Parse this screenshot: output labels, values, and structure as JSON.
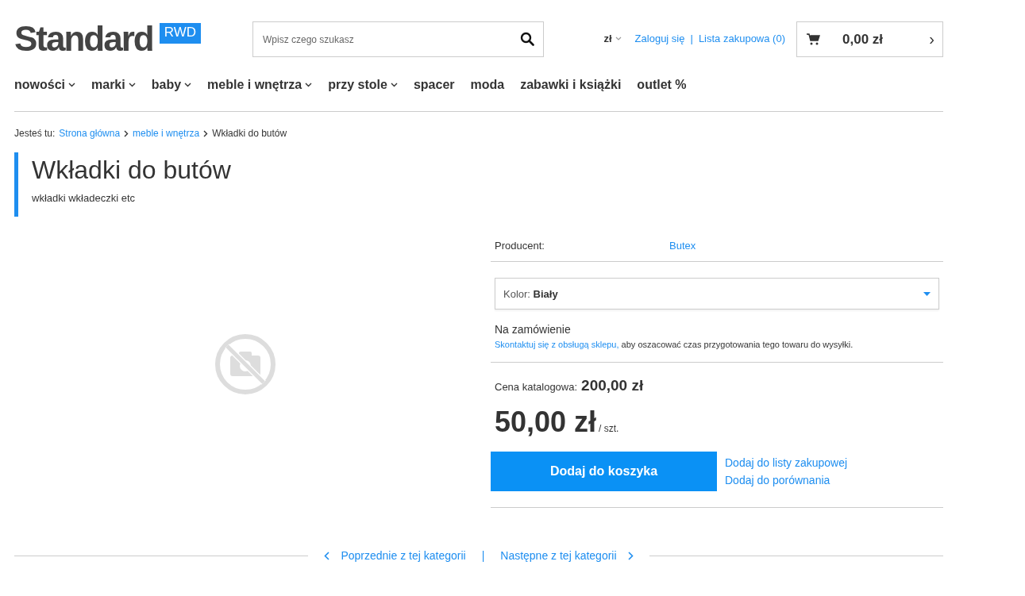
{
  "logo": {
    "text": "Standard",
    "badge": "RWD"
  },
  "search": {
    "placeholder": "Wpisz czego szukasz"
  },
  "currency": {
    "label": "zł",
    "has_dropdown": true
  },
  "account_links": [
    {
      "label": "Zaloguj się"
    },
    {
      "label": "Lista zakupowa (0)"
    }
  ],
  "account_separator": "|",
  "cart": {
    "total": "0,00 zł",
    "arrow": "›"
  },
  "nav": [
    {
      "label": "nowości",
      "has_dropdown": true
    },
    {
      "label": "marki",
      "has_dropdown": true
    },
    {
      "label": "baby",
      "has_dropdown": true
    },
    {
      "label": "meble i wnętrza",
      "has_dropdown": true
    },
    {
      "label": "przy stole",
      "has_dropdown": true
    },
    {
      "label": "spacer",
      "has_dropdown": false
    },
    {
      "label": "moda",
      "has_dropdown": false
    },
    {
      "label": "zabawki i książki",
      "has_dropdown": false
    },
    {
      "label": "outlet %",
      "has_dropdown": false
    }
  ],
  "breadcrumb": {
    "prefix": "Jesteś tu:",
    "items": [
      {
        "label": "Strona główna",
        "link": true
      },
      {
        "label": "meble i wnętrza",
        "link": true
      },
      {
        "label": "Wkładki do butów",
        "link": false
      }
    ]
  },
  "product": {
    "title": "Wkładki do butów",
    "subtitle": "wkładki wkładeczki etc",
    "producer_label": "Producent:",
    "producer": "Butex",
    "variant": {
      "label": "Kolor:",
      "value": "Biały"
    },
    "availability": "Na zamówienie",
    "availability_link": "Skontaktuj się z obsługą sklepu,",
    "availability_note": " aby oszacować czas przygotowania tego towaru do wysyłki.",
    "list_price_label": "Cena katalogowa:",
    "list_price": "200,00 zł",
    "price": "50,00 zł",
    "unit": "/ szt.",
    "add_to_cart": "Dodaj do koszyka",
    "side_links": [
      {
        "label": "Dodaj do listy zakupowej"
      },
      {
        "label": "Dodaj do porównania"
      }
    ]
  },
  "pager": {
    "previous": "Poprzednie z tej kategorii",
    "separator": "|",
    "next": "Następne z tej kategorii"
  }
}
